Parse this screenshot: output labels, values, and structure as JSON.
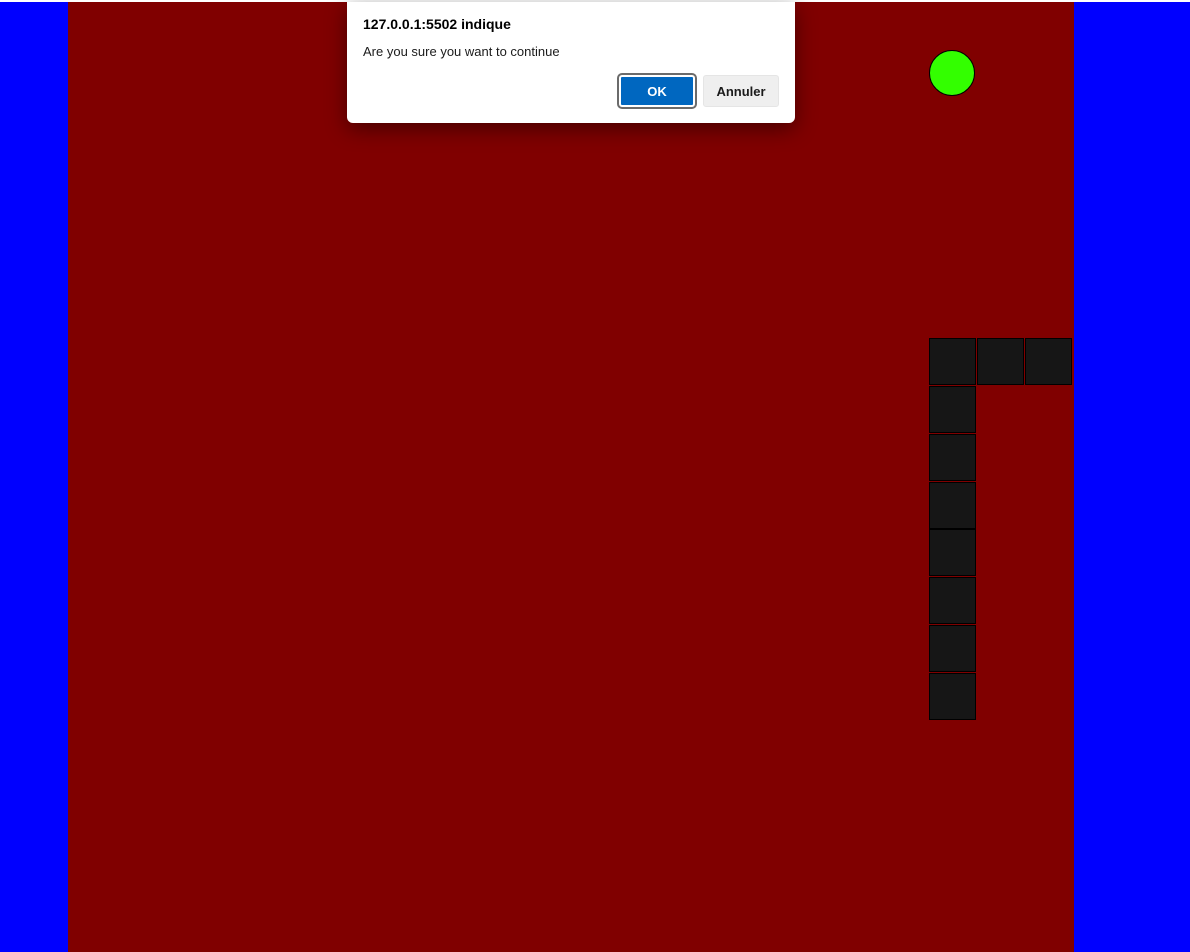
{
  "game": {
    "colors": {
      "outside": "#0000ff",
      "board": "#800000",
      "snake": "#161616",
      "food": "#33ff00"
    },
    "snake_segments": 10,
    "food_count": 1
  },
  "dialog": {
    "title": "127.0.0.1:5502 indique",
    "message": "Are you sure you want to continue",
    "ok_label": "OK",
    "cancel_label": "Annuler"
  }
}
